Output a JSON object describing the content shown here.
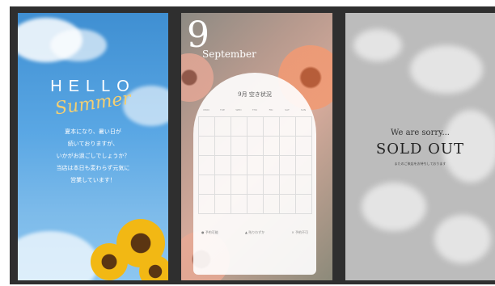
{
  "panel1": {
    "hello": "HELLO",
    "summer": "Summer",
    "lines": [
      "夏本になり、暑い日が",
      "続いておりますが、",
      "いかがお過ごしでしょうか？",
      "当店は本日も変わらず元気に",
      "営業しています！"
    ]
  },
  "panel2": {
    "day": "9",
    "month": "September",
    "calendar_title": "9月 空き状況",
    "weekdays": [
      "MON",
      "TUE",
      "WED",
      "THU",
      "FRI",
      "SAT",
      "SUN"
    ],
    "legend": [
      "● 予約可能",
      "▲ 残りわずか",
      "× 予約不可"
    ]
  },
  "panel3": {
    "sorry": "We are sorry...",
    "sold_out": "SOLD OUT",
    "message": "またのご来店をお待ちしております"
  }
}
